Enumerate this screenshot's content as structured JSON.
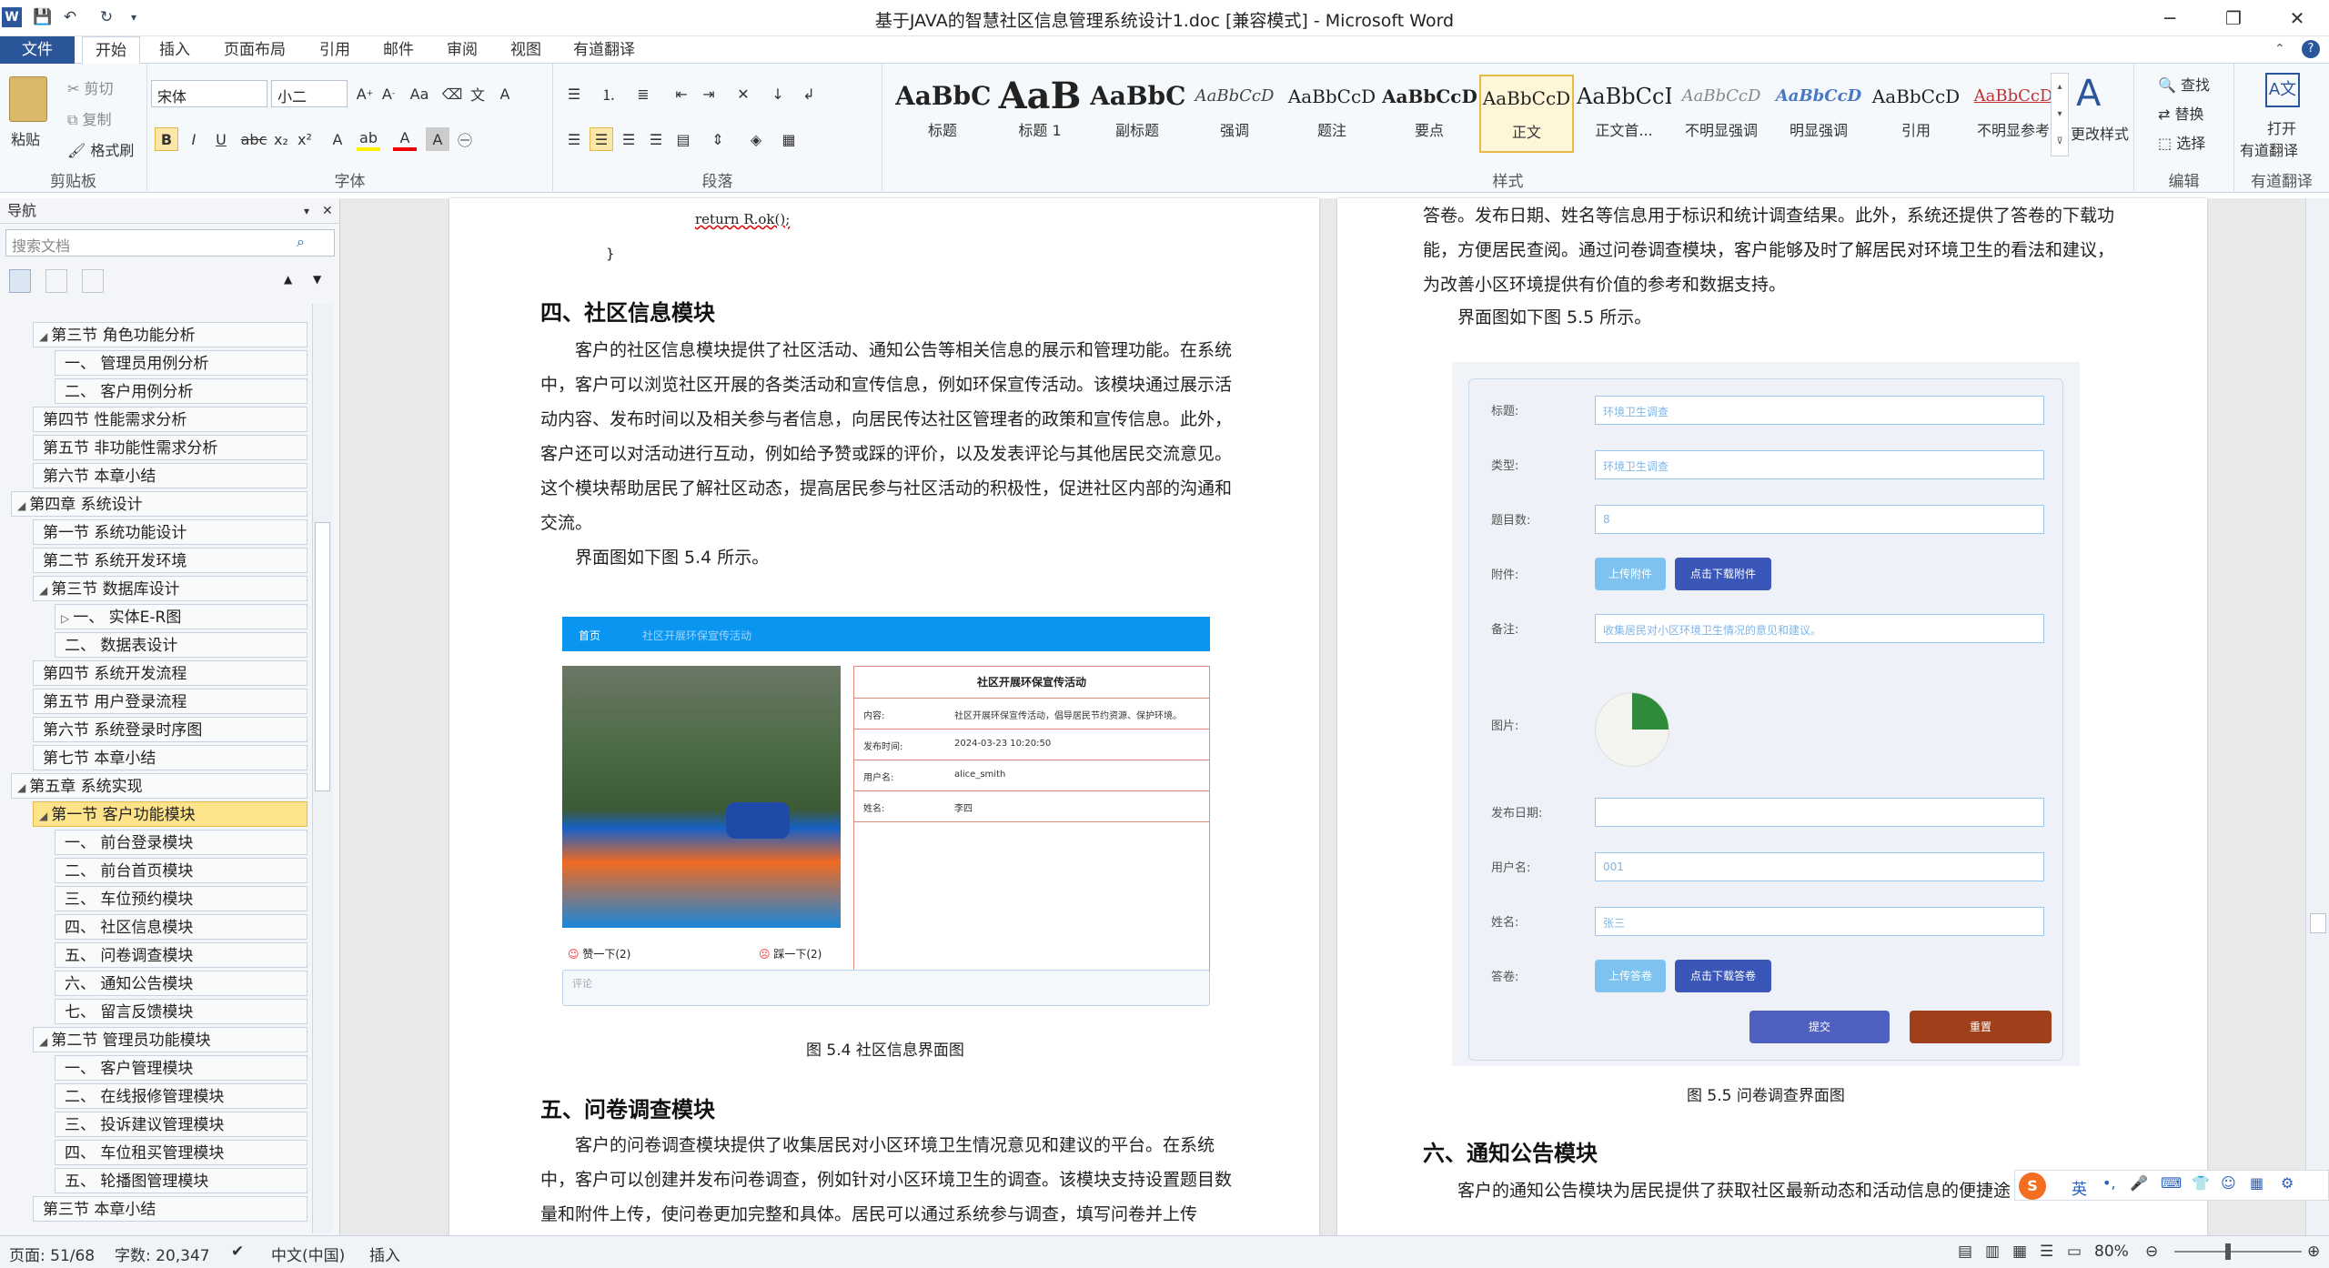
{
  "window": {
    "title": "基于JAVA的智慧社区信息管理系统设计1.doc [兼容模式] - Microsoft Word",
    "word_logo": "W"
  },
  "tabs": [
    "文件",
    "开始",
    "插入",
    "页面布局",
    "引用",
    "邮件",
    "审阅",
    "视图",
    "有道翻译"
  ],
  "clipboard": {
    "paste": "粘贴",
    "cut": "剪切",
    "copy": "复制",
    "format_painter": "格式刷",
    "label": "剪贴板"
  },
  "font": {
    "name": "宋体",
    "size": "小二",
    "label": "字体"
  },
  "paragraph": {
    "label": "段落"
  },
  "styles": {
    "label": "样式",
    "items": [
      {
        "preview": "AaBbC",
        "name": "标题"
      },
      {
        "preview": "AaB",
        "name": "标题 1"
      },
      {
        "preview": "AaBbC",
        "name": "副标题"
      },
      {
        "preview": "AaBbCcD",
        "name": "强调"
      },
      {
        "preview": "AaBbCcD",
        "name": "题注"
      },
      {
        "preview": "AaBbCcD",
        "name": "要点"
      },
      {
        "preview": "AaBbCcD",
        "name": "正文"
      },
      {
        "preview": "AaBbCcI",
        "name": "正文首..."
      },
      {
        "preview": "AaBbCcD",
        "name": "不明显强调"
      },
      {
        "preview": "AaBbCcD",
        "name": "明显强调"
      },
      {
        "preview": "AaBbCcD",
        "name": "引用"
      },
      {
        "preview": "AaBbCcD",
        "name": "不明显参考"
      }
    ],
    "change": "更改样式"
  },
  "editing": {
    "find": "查找",
    "replace": "替换",
    "select": "选择",
    "label": "编辑"
  },
  "youdao": {
    "open": "打开",
    "open2": "有道翻译",
    "label": "有道翻译"
  },
  "nav": {
    "title": "导航",
    "search_placeholder": "搜索文档",
    "items": [
      {
        "text": "第三节  角色功能分析",
        "level": 2,
        "tri": "◢"
      },
      {
        "text": "一、 管理员用例分析",
        "level": 3,
        "tri": ""
      },
      {
        "text": "二、 客户用例分析",
        "level": 3,
        "tri": ""
      },
      {
        "text": "第四节  性能需求分析",
        "level": 2,
        "tri": ""
      },
      {
        "text": "第五节  非功能性需求分析",
        "level": 2,
        "tri": ""
      },
      {
        "text": "第六节  本章小结",
        "level": 2,
        "tri": ""
      },
      {
        "text": "第四章  系统设计",
        "level": 1,
        "tri": "◢"
      },
      {
        "text": "第一节  系统功能设计",
        "level": 2,
        "tri": ""
      },
      {
        "text": "第二节  系统开发环境",
        "level": 2,
        "tri": ""
      },
      {
        "text": "第三节  数据库设计",
        "level": 2,
        "tri": "◢"
      },
      {
        "text": "一、 实体E-R图",
        "level": 3,
        "tri": "▷"
      },
      {
        "text": "二、 数据表设计",
        "level": 3,
        "tri": ""
      },
      {
        "text": "第四节  系统开发流程",
        "level": 2,
        "tri": ""
      },
      {
        "text": "第五节  用户登录流程",
        "level": 2,
        "tri": ""
      },
      {
        "text": "第六节  系统登录时序图",
        "level": 2,
        "tri": ""
      },
      {
        "text": "第七节  本章小结",
        "level": 2,
        "tri": ""
      },
      {
        "text": "第五章  系统实现",
        "level": 1,
        "tri": "◢"
      },
      {
        "text": "第一节  客户功能模块",
        "level": 2,
        "tri": "◢",
        "selected": true
      },
      {
        "text": "一、 前台登录模块",
        "level": 3,
        "tri": ""
      },
      {
        "text": "二、 前台首页模块",
        "level": 3,
        "tri": ""
      },
      {
        "text": "三、 车位预约模块",
        "level": 3,
        "tri": ""
      },
      {
        "text": "四、 社区信息模块",
        "level": 3,
        "tri": ""
      },
      {
        "text": "五、 问卷调查模块",
        "level": 3,
        "tri": ""
      },
      {
        "text": "六、 通知公告模块",
        "level": 3,
        "tri": ""
      },
      {
        "text": "七、 留言反馈模块",
        "level": 3,
        "tri": ""
      },
      {
        "text": "第二节  管理员功能模块",
        "level": 2,
        "tri": "◢"
      },
      {
        "text": "一、 客户管理模块",
        "level": 3,
        "tri": ""
      },
      {
        "text": "二、 在线报修管理模块",
        "level": 3,
        "tri": ""
      },
      {
        "text": "三、 投诉建议管理模块",
        "level": 3,
        "tri": ""
      },
      {
        "text": "四、 车位租买管理模块",
        "level": 3,
        "tri": ""
      },
      {
        "text": "五、 轮播图管理模块",
        "level": 3,
        "tri": ""
      },
      {
        "text": "第三节  本章小结",
        "level": 2,
        "tri": ""
      }
    ]
  },
  "left_page": {
    "code1": "return R.ok();",
    "code2": "}",
    "h4": "四、社区信息模块",
    "para1": "客户的社区信息模块提供了社区活动、通知公告等相关信息的展示和管理功能。在系统中，客户可以浏览社区开展的各类活动和宣传信息，例如环保宣传活动。该模块通过展示活动内容、发布时间以及相关参与者信息，向居民传达社区管理者的政策和宣传信息。此外，客户还可以对活动进行互动，例如给予赞或踩的评价，以及发表评论与其他居民交流意见。这个模块帮助居民了解社区动态，提高居民参与社区活动的积极性，促进社区内部的沟通和交流。",
    "para2": "界面图如下图 5.4 所示。",
    "fig_caption": "图 5.4 社区信息界面图",
    "h5": "五、问卷调查模块",
    "para3": "客户的问卷调查模块提供了收集居民对小区环境卫生情况意见和建议的平台。在系统中，客户可以创建并发布问卷调查，例如针对小区环境卫生的调查。该模块支持设置题目数量和附件上传，使问卷更加完整和具体。居民可以通过系统参与调查，填写问卷并上传"
  },
  "fig54": {
    "nav_home": "首页",
    "nav_crumb": "社区开展环保宣传活动",
    "card_title": "社区开展环保宣传活动",
    "rows": [
      {
        "k": "内容:",
        "v": "社区开展环保宣传活动，倡导居民节约资源、保护环境。"
      },
      {
        "k": "发布时间:",
        "v": "2024-03-23 10:20:50"
      },
      {
        "k": "用户名:",
        "v": "alice_smith"
      },
      {
        "k": "姓名:",
        "v": "李四"
      }
    ],
    "like": "赞一下(2)",
    "dislike": "踩一下(2)",
    "comment_placeholder": "评论"
  },
  "right_page": {
    "para1": "答卷。发布日期、姓名等信息用于标识和统计调查结果。此外，系统还提供了答卷的下载功能，方便居民查阅。通过问卷调查模块，客户能够及时了解居民对环境卫生的看法和建议，为改善小区环境提供有价值的参考和数据支持。",
    "para2": "界面图如下图 5.5 所示。",
    "fig_caption": "图 5.5 问卷调查界面图",
    "h6": "六、通知公告模块",
    "para3": "客户的通知公告模块为居民提供了获取社区最新动态和活动信息的便捷途"
  },
  "fig55": {
    "fields": [
      {
        "k": "标题:",
        "v": "环境卫生调查"
      },
      {
        "k": "类型:",
        "v": "环境卫生调查"
      },
      {
        "k": "题目数:",
        "v": "8"
      }
    ],
    "attach_label": "附件:",
    "upload": "上传附件",
    "download": "点击下载附件",
    "remark_label": "备注:",
    "remark": "收集居民对小区环境卫生情况的意见和建议。",
    "image_label": "图片:",
    "date_label": "发布日期:",
    "user_label": "用户名:",
    "user": "001",
    "name_label": "姓名:",
    "name": "张三",
    "answer_label": "答卷:",
    "upload2": "上传答卷",
    "download2": "点击下载答卷",
    "submit": "提交",
    "reset": "重置"
  },
  "status": {
    "page": "页面: 51/68",
    "words": "字数: 20,347",
    "lang": "中文(中国)",
    "mode": "插入",
    "zoom": "80%"
  },
  "ime": {
    "lang": "英"
  },
  "colors": {
    "accent": "#2b579a",
    "nav_select": "#fde38a",
    "fig_blue": "#0a96f0",
    "fig_submit": "#5060c0",
    "fig_reset": "#a0401a"
  }
}
